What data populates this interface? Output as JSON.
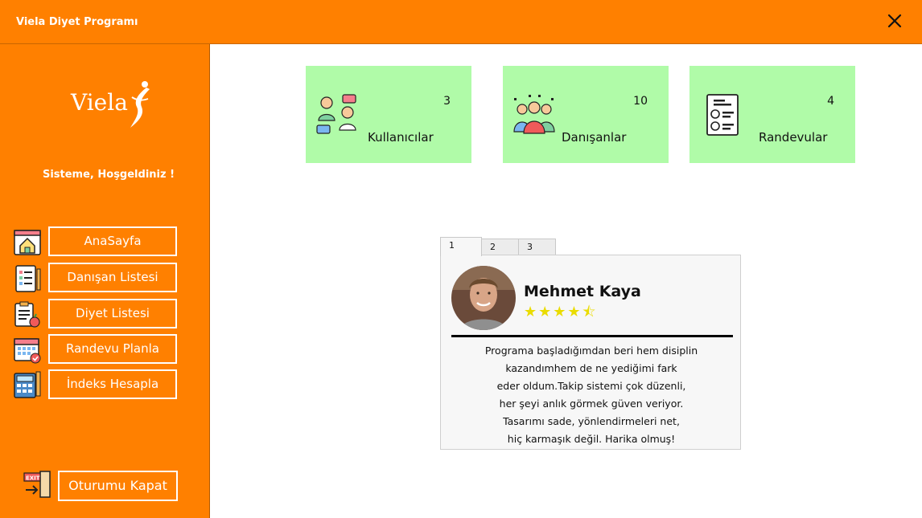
{
  "window": {
    "title": "Viela Diyet Programı",
    "close_icon": "close-icon"
  },
  "sidebar": {
    "logo_text": "Viela",
    "welcome": "Sisteme, Hoşgeldiniz !",
    "nav": [
      {
        "label": "AnaSayfa",
        "icon": "home-window-icon"
      },
      {
        "label": "Danışan Listesi",
        "icon": "checklist-icon"
      },
      {
        "label": "Diyet Listesi",
        "icon": "diet-clipboard-icon"
      },
      {
        "label": "Randevu Planla",
        "icon": "calendar-check-icon"
      },
      {
        "label": "İndeks Hesapla",
        "icon": "calculator-icon"
      }
    ],
    "logout": {
      "label": "Oturumu Kapat",
      "icon": "exit-door-icon"
    }
  },
  "cards": [
    {
      "count": "3",
      "label": "Kullanıcılar",
      "icon": "users-chat-icon"
    },
    {
      "count": "10",
      "label": "Danışanlar",
      "icon": "group-people-icon"
    },
    {
      "count": "4",
      "label": "Randevular",
      "icon": "appointment-document-icon"
    }
  ],
  "testimonials": {
    "tabs": [
      "1",
      "2",
      "3"
    ],
    "active_tab": "1",
    "name": "Mehmet Kaya",
    "rating": 4.5,
    "stars_text": "★★★★⯪",
    "review_lines": [
      "Programa başladığımdan beri hem disiplin",
      "kazandımhem de ne yediğimi fark",
      "eder oldum.Takip sistemi çok düzenli,",
      "her şeyi anlık görmek güven veriyor.",
      "Tasarımı sade, yönlendirmeleri net,",
      "hiç karmaşık değil. Harika olmuş!"
    ]
  },
  "colors": {
    "accent": "#ff8000",
    "card_bg": "#b0fba8",
    "star": "#eadc00"
  }
}
